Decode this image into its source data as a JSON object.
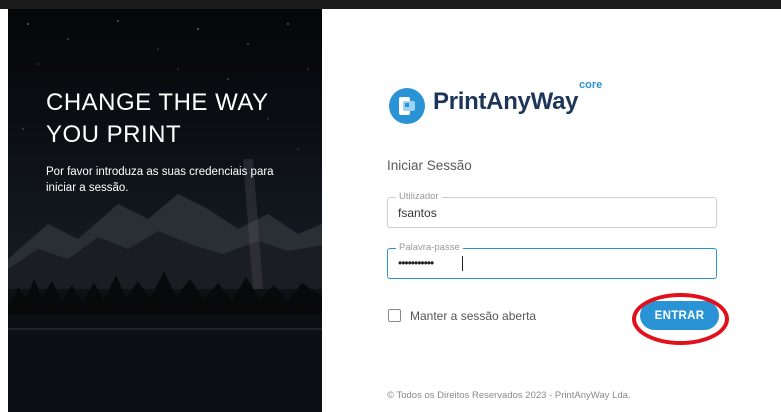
{
  "left_panel": {
    "headline_line1": "CHANGE THE WAY",
    "headline_line2": "YOU PRINT",
    "subtext": "Por favor introduza as suas credenciais para iniciar a sessão."
  },
  "logo": {
    "brand": "PrintAnyWay",
    "superscript": "core",
    "icon": "print-any-way-logo-icon",
    "brand_color": "#1d3559",
    "accent_color": "#2a93d5"
  },
  "login": {
    "title": "Iniciar Sessão",
    "username": {
      "label": "Utilizador",
      "value": "fsantos"
    },
    "password": {
      "label": "Palavra-passe",
      "value": "•••••••••••"
    },
    "remember_label": "Manter a sessão aberta",
    "remember_checked": false,
    "submit_label": "ENTRAR"
  },
  "footer": "© Todos os Direitos Reservados 2023 - PrintAnyWay Lda.",
  "annotation": {
    "type": "highlight-ring",
    "color": "#e3101b",
    "target": "submit-button"
  }
}
